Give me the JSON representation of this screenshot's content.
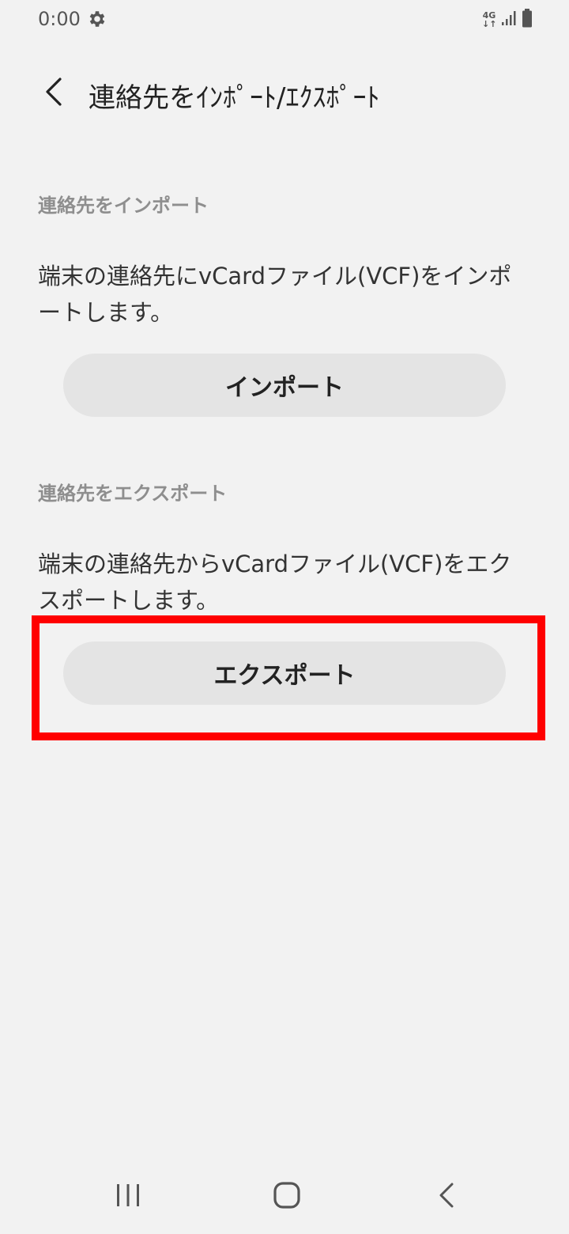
{
  "status_bar": {
    "time": "0:00",
    "network_type_top": "4G",
    "network_type_bottom": "↓↑"
  },
  "app_bar": {
    "title": "連絡先をｲﾝﾎﾟｰﾄ/ｴｸｽﾎﾟｰﾄ"
  },
  "import_section": {
    "header": "連絡先をインポート",
    "description": "端末の連絡先にvCardファイル(VCF)をインポートします。",
    "button_label": "インポート"
  },
  "export_section": {
    "header": "連絡先をエクスポート",
    "description": "端末の連絡先からvCardファイル(VCF)をエクスポートします。",
    "button_label": "エクスポート"
  },
  "colors": {
    "background": "#f2f2f2",
    "button_background": "#e4e4e4",
    "section_header": "#8e8e8e",
    "highlight": "#ff0000"
  },
  "icons": {
    "settings": "gear-icon",
    "signal": "signal-icon",
    "battery": "battery-icon",
    "back": "chevron-left-icon",
    "recent_apps": "recent-apps-icon",
    "home": "home-icon",
    "nav_back": "nav-back-icon"
  }
}
